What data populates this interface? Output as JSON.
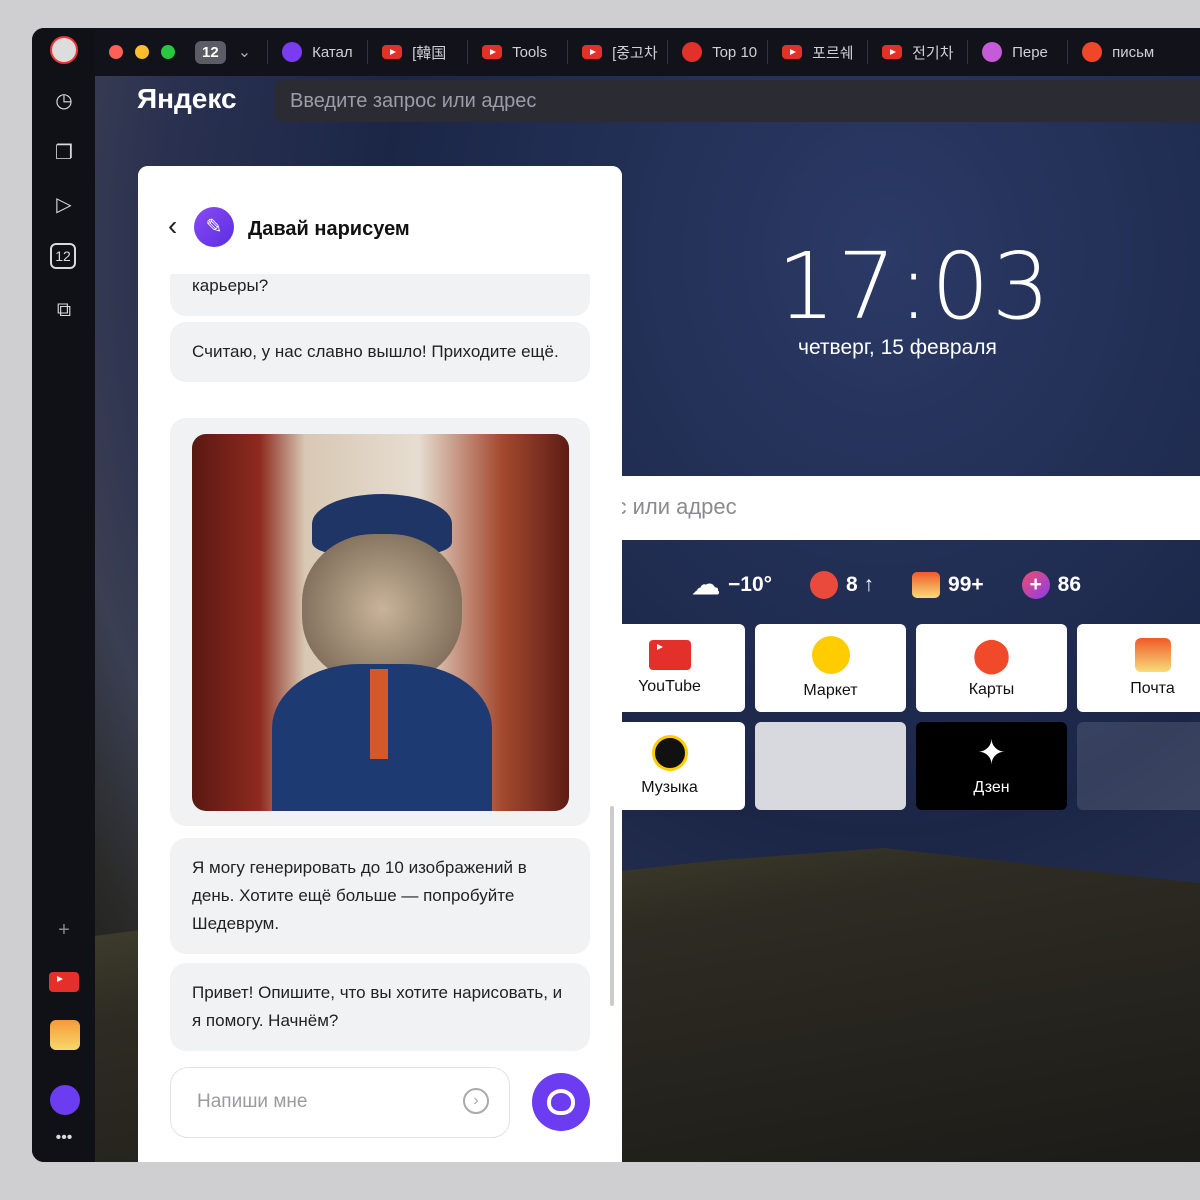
{
  "tabs": {
    "count": "12",
    "items": [
      {
        "label": "Катал",
        "icon": "alice-icon",
        "color": "#7a3cf0"
      },
      {
        "label": "[韓国",
        "icon": "youtube-icon"
      },
      {
        "label": "Tools",
        "icon": "youtube-icon"
      },
      {
        "label": "[중고차",
        "icon": "youtube-icon"
      },
      {
        "label": "Top 10",
        "icon": "clock-red-icon",
        "color": "#e4302b"
      },
      {
        "label": "포르쉐",
        "icon": "youtube-icon"
      },
      {
        "label": "전기차",
        "icon": "youtube-icon"
      },
      {
        "label": "Пере",
        "icon": "translate-icon",
        "color": "#c55bd8"
      },
      {
        "label": "письм",
        "icon": "yandex-icon",
        "color": "#f0472b"
      }
    ]
  },
  "browser": {
    "logo": "Яндекс",
    "address_placeholder": "Введите запрос или адрес"
  },
  "newtab": {
    "time": "17:03",
    "date": "четверг, 15 февраля",
    "search_placeholder": "рос или адрес",
    "widgets": [
      {
        "icon": "weather-snow-icon",
        "value": "−10°"
      },
      {
        "icon": "traffic-icon",
        "value": "8 ↑"
      },
      {
        "icon": "mail-icon",
        "value": "99+"
      },
      {
        "icon": "plus-icon",
        "value": "86"
      }
    ],
    "tiles": [
      {
        "label": "YouTube"
      },
      {
        "label": "Маркет"
      },
      {
        "label": "Карты"
      },
      {
        "label": "Почта"
      },
      {
        "label": "Музыка"
      },
      {
        "label": ""
      },
      {
        "label": "Дзен"
      },
      {
        "label": ""
      }
    ]
  },
  "assistant": {
    "title": "Давай нарисуем",
    "messages": [
      "карьеры?",
      "Считаю, у нас славно вышло! Приходите ещё.",
      "Я могу генерировать до 10 изображений в день. Хотите ещё больше — попробуйте Шедеврум.",
      "Привет! Опишите, что вы хотите нарисовать, и я помогу. Начнём?"
    ],
    "input_placeholder": "Напиши мне"
  },
  "colors": {
    "accent": "#6b3cf0",
    "youtube": "#e4302b"
  }
}
